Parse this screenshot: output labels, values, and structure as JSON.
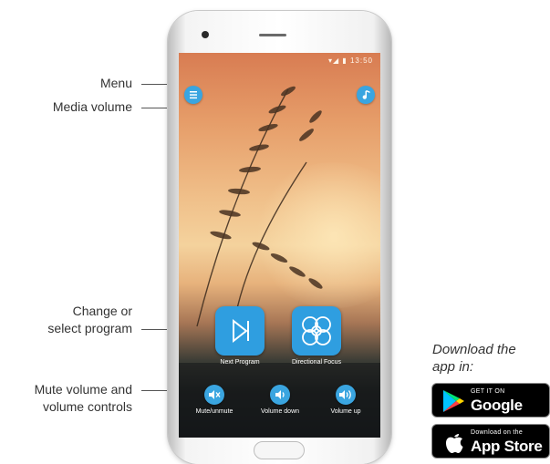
{
  "callouts": {
    "menu": "Menu",
    "media_volume": "Media volume",
    "change_program_line1": "Change or",
    "change_program_line2": "select program",
    "mute_line1": "Mute volume and",
    "mute_line2": "volume controls"
  },
  "screen": {
    "status_text": "▾◢ ▮ 13:50",
    "menu_icon": "menu-icon",
    "music_icon": "music-note-icon",
    "next_program_label": "Next Program",
    "directional_focus_label": "Directional Focus",
    "mute_label": "Mute/unmute",
    "volume_down_label": "Volume down",
    "volume_up_label": "Volume up"
  },
  "download": {
    "line1": "Download the",
    "line2": "app in:",
    "google_small": "GET IT ON",
    "google_big": "Google Play",
    "apple_small": "Download on the",
    "apple_big": "App Store"
  },
  "colors": {
    "accent": "#3aa5e0",
    "badge": "#000000"
  }
}
